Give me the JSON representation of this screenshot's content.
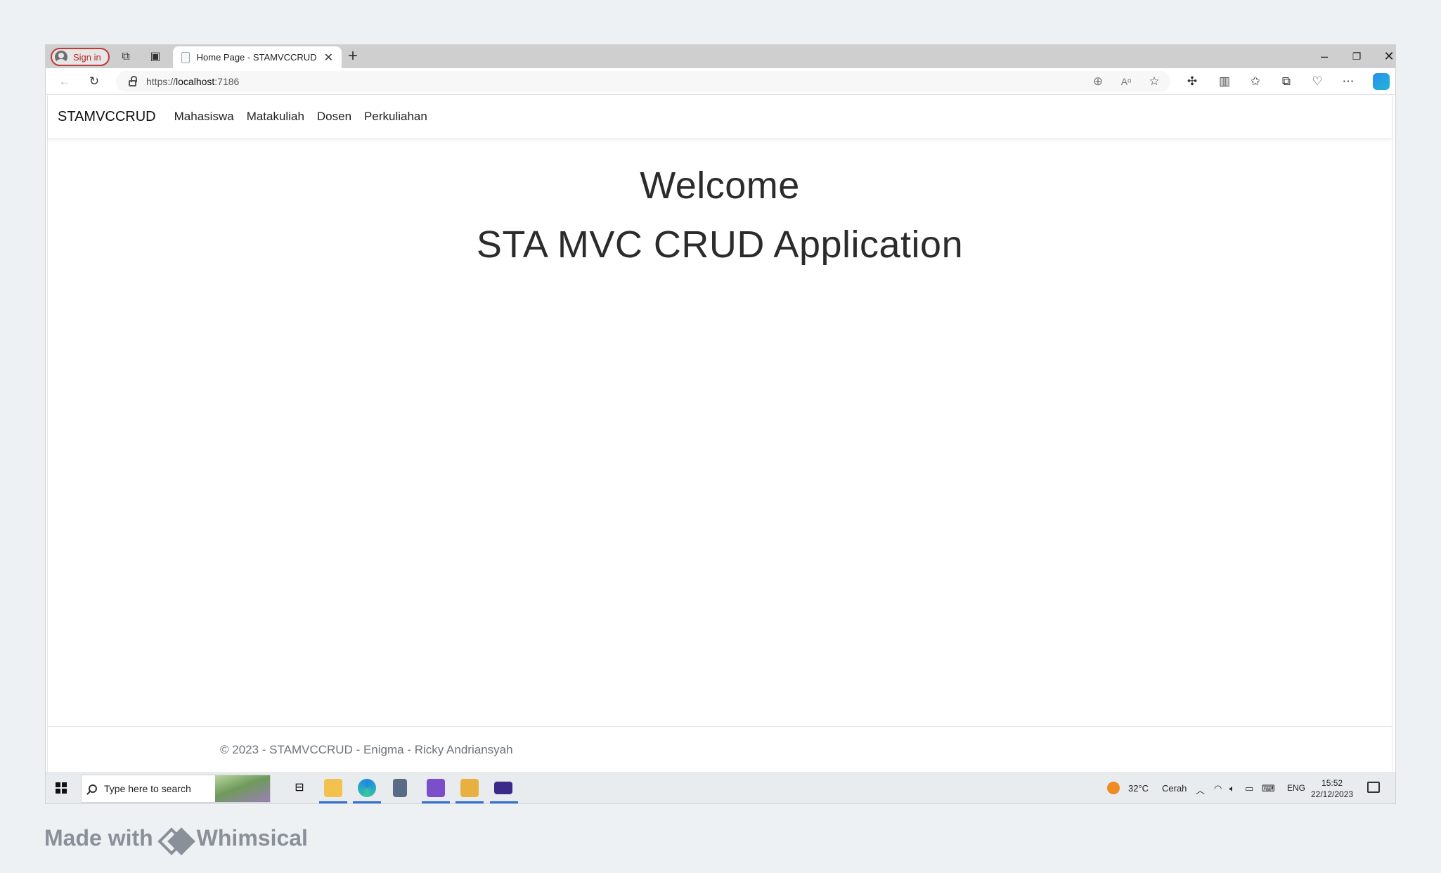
{
  "browser": {
    "signin_label": "Sign in",
    "tab_title": "Home Page - STAMVCCRUD",
    "url_scheme": "https://",
    "url_host": "localhost",
    "url_port": ":7186"
  },
  "navbar": {
    "brand": "STAMVCCRUD",
    "links": [
      "Mahasiswa",
      "Matakuliah",
      "Dosen",
      "Perkuliahan"
    ]
  },
  "hero": {
    "line1": "Welcome",
    "line2": "STA MVC CRUD Application"
  },
  "footer": {
    "text": "© 2023 - STAMVCCRUD - Enigma - Ricky Andriansyah"
  },
  "taskbar": {
    "search_placeholder": "Type here to search",
    "weather_temp": "32°C",
    "weather_desc": "Cerah",
    "language": "ENG",
    "time": "15:52",
    "date": "22/12/2023"
  },
  "watermark": {
    "made_with": "Made with",
    "brand": "Whimsical"
  }
}
